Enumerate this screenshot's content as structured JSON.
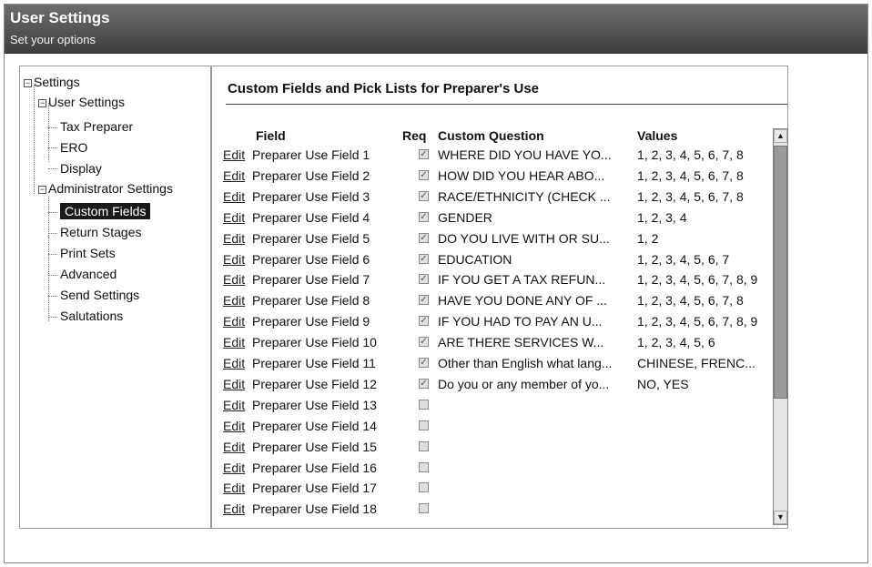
{
  "header": {
    "title": "User Settings",
    "subtitle": "Set your options"
  },
  "tree": {
    "root": "Settings",
    "groups": [
      {
        "label": "User Settings",
        "items": [
          "Tax Preparer",
          "ERO",
          "Display"
        ]
      },
      {
        "label": "Administrator Settings",
        "items": [
          "Custom Fields",
          "Return Stages",
          "Print Sets",
          "Advanced",
          "Send Settings",
          "Salutations"
        ]
      }
    ],
    "selected": "Custom Fields"
  },
  "main": {
    "title": "Custom Fields and Pick Lists for Preparer's Use",
    "columns": {
      "field": "Field",
      "req": "Req",
      "question": "Custom Question",
      "values": "Values"
    },
    "edit_label": "Edit",
    "rows": [
      {
        "field": "Preparer Use Field 1",
        "req": true,
        "question": "WHERE DID YOU HAVE YO...",
        "values": "1, 2, 3, 4, 5, 6, 7, 8"
      },
      {
        "field": "Preparer Use Field 2",
        "req": true,
        "question": "HOW DID YOU HEAR ABO...",
        "values": "1, 2, 3, 4, 5, 6, 7, 8"
      },
      {
        "field": "Preparer Use Field 3",
        "req": true,
        "question": "RACE/ETHNICITY (CHECK ...",
        "values": "1, 2, 3, 4, 5, 6, 7, 8"
      },
      {
        "field": "Preparer Use Field 4",
        "req": true,
        "question": "GENDER",
        "values": "1, 2, 3, 4"
      },
      {
        "field": "Preparer Use Field 5",
        "req": true,
        "question": "DO YOU LIVE WITH OR SU...",
        "values": "1, 2"
      },
      {
        "field": "Preparer Use Field 6",
        "req": true,
        "question": "EDUCATION",
        "values": "1, 2, 3, 4, 5, 6, 7"
      },
      {
        "field": "Preparer Use Field 7",
        "req": true,
        "question": "IF YOU GET A TAX REFUN...",
        "values": "1, 2, 3, 4, 5, 6, 7, 8, 9"
      },
      {
        "field": "Preparer Use Field 8",
        "req": true,
        "question": "HAVE YOU DONE ANY OF ...",
        "values": "1, 2, 3, 4, 5, 6, 7, 8"
      },
      {
        "field": "Preparer Use Field 9",
        "req": true,
        "question": "IF YOU HAD TO PAY AN U...",
        "values": "1, 2, 3, 4, 5, 6, 7, 8, 9"
      },
      {
        "field": "Preparer Use Field 10",
        "req": true,
        "question": "ARE THERE SERVICES W...",
        "values": "1, 2, 3, 4, 5, 6"
      },
      {
        "field": "Preparer Use Field 11",
        "req": true,
        "question": "Other than English what lang...",
        "values": "CHINESE, FRENC..."
      },
      {
        "field": "Preparer Use Field 12",
        "req": true,
        "question": "Do you or any member of yo...",
        "values": "NO, YES"
      },
      {
        "field": "Preparer Use Field 13",
        "req": false,
        "question": "",
        "values": ""
      },
      {
        "field": "Preparer Use Field 14",
        "req": false,
        "question": "",
        "values": ""
      },
      {
        "field": "Preparer Use Field 15",
        "req": false,
        "question": "",
        "values": ""
      },
      {
        "field": "Preparer Use Field 16",
        "req": false,
        "question": "",
        "values": ""
      },
      {
        "field": "Preparer Use Field 17",
        "req": false,
        "question": "",
        "values": ""
      },
      {
        "field": "Preparer Use Field 18",
        "req": false,
        "question": "",
        "values": ""
      }
    ]
  }
}
